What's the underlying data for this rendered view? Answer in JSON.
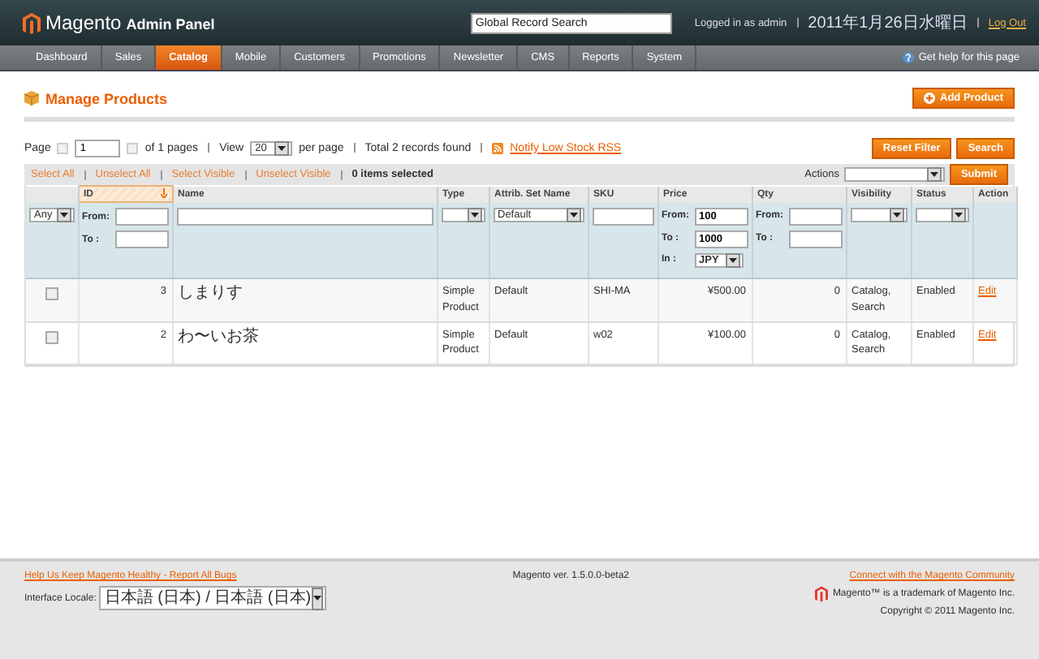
{
  "header": {
    "logo": "Magento",
    "logo_sub": "Admin Panel",
    "search": {
      "placeholder": "Global Record Search"
    },
    "user": "Logged in as admin",
    "date": "2011年1月26日水曜日",
    "logout": "Log Out"
  },
  "nav": {
    "items": [
      {
        "label": "Dashboard",
        "selected": false
      },
      {
        "label": "Sales",
        "selected": false
      },
      {
        "label": "Catalog",
        "selected": true
      },
      {
        "label": "Mobile",
        "selected": false
      },
      {
        "label": "Customers",
        "selected": false
      },
      {
        "label": "Promotions",
        "selected": false
      },
      {
        "label": "Newsletter",
        "selected": false
      },
      {
        "label": "CMS",
        "selected": false
      },
      {
        "label": "Reports",
        "selected": false
      },
      {
        "label": "System",
        "selected": false
      }
    ],
    "help": "Get help for this page"
  },
  "page": {
    "title": "Manage Products",
    "add_button": "Add Product"
  },
  "pager": {
    "page_label": "Page",
    "page": "1",
    "of_pages": "of 1 pages",
    "view_label": "View",
    "view": "20",
    "per_page": "per page",
    "total": "Total 2 records found",
    "rss": "Notify Low Stock RSS",
    "reset_button": "Reset Filter",
    "search_button": "Search"
  },
  "massaction": {
    "links": [
      "Select All",
      "Unselect All",
      "Select Visible",
      "Unselect Visible"
    ],
    "selected_count": "0 items selected",
    "actions_label": "Actions",
    "submit": "Submit"
  },
  "table": {
    "checkbox_filter": {
      "value": "Any"
    },
    "columns": [
      {
        "label": "ID",
        "sorted": true
      },
      {
        "label": "Name",
        "sorted": false
      },
      {
        "label": "Type",
        "sorted": false
      },
      {
        "label": "Attrib. Set Name",
        "sorted": false
      },
      {
        "label": "SKU",
        "sorted": false
      },
      {
        "label": "Price",
        "sorted": false
      },
      {
        "label": "Qty",
        "sorted": false
      },
      {
        "label": "Visibility",
        "sorted": false
      },
      {
        "label": "Status",
        "sorted": false
      },
      {
        "label": "Action",
        "sorted": false
      }
    ],
    "filters": [
      {
        "kind": "range",
        "from_label": "From:",
        "to_label": "To :"
      },
      {
        "kind": "text"
      },
      {
        "kind": "select"
      },
      {
        "kind": "select",
        "value": "Default"
      },
      {
        "kind": "text"
      },
      {
        "kind": "price",
        "from_label": "From:",
        "from": "100",
        "to_label": "To :",
        "to": "1000",
        "currency_label": "In :",
        "currency": "JPY"
      },
      {
        "kind": "range",
        "from_label": "From:",
        "to_label": "To :"
      },
      {
        "kind": "select"
      },
      {
        "kind": "select"
      },
      {
        "kind": "none"
      }
    ],
    "rows": [
      {
        "checked": false,
        "cells": [
          "3",
          "しまりす",
          "Simple Product",
          "Default",
          "SHI-MA",
          "¥500.00",
          "0",
          "Catalog, Search",
          "Enabled",
          "Edit"
        ]
      },
      {
        "checked": false,
        "cells": [
          "2",
          "わ〜いお茶",
          "Simple Product",
          "Default",
          "w02",
          "¥100.00",
          "0",
          "Catalog, Search",
          "Enabled",
          "Edit"
        ]
      }
    ]
  },
  "footer": {
    "bugs_link": "Help Us Keep Magento Healthy - Report All Bugs",
    "locale_label": "Interface Locale:",
    "locale": "日本語 (日本) / 日本語 (日本)",
    "version": "Magento ver. 1.5.0.0-beta2",
    "community_link": "Connect with the Magento Community",
    "trademark": "Magento™ is a trademark of Magento Inc.",
    "copyright": "Copyright © 2011 Magento Inc."
  }
}
